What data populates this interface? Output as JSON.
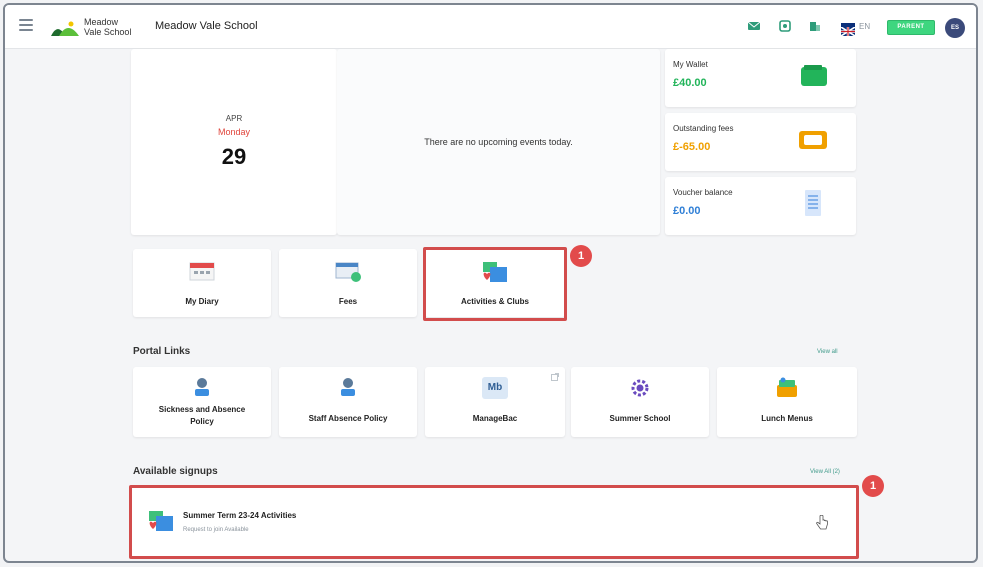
{
  "header": {
    "logo_line1": "Meadow",
    "logo_line2": "Vale School",
    "school_name": "Meadow Vale School",
    "language": "EN",
    "role_badge": "PARENT",
    "avatar_initials": "ES"
  },
  "date_card": {
    "month": "APR",
    "weekday": "Monday",
    "day": "29"
  },
  "events": {
    "empty_message": "There are no upcoming events today."
  },
  "wallet": [
    {
      "label": "My Wallet",
      "value": "£40.00",
      "color": "#22b45a"
    },
    {
      "label": "Outstanding fees",
      "value": "£-65.00",
      "color": "#f0a000"
    },
    {
      "label": "Voucher balance",
      "value": "£0.00",
      "color": "#2f7fd6"
    }
  ],
  "quick_tiles": [
    {
      "label": "My Diary"
    },
    {
      "label": "Fees"
    },
    {
      "label": "Activities & Clubs"
    }
  ],
  "portal_links": {
    "title": "Portal Links",
    "view_all": "View all",
    "items": [
      {
        "label_line1": "Sickness and Absence",
        "label_line2": "Policy"
      },
      {
        "label_line1": "Staff Absence Policy",
        "label_line2": ""
      },
      {
        "label_line1": "ManageBac",
        "label_line2": "",
        "icon_text": "Mb"
      },
      {
        "label_line1": "Summer School",
        "label_line2": ""
      },
      {
        "label_line1": "Lunch Menus",
        "label_line2": ""
      }
    ]
  },
  "signups": {
    "title": "Available signups",
    "view_all": "View All (2)",
    "items": [
      {
        "title": "Summer Term 23-24 Activities",
        "subtitle": "Request to join Available"
      }
    ]
  },
  "annotations": {
    "step_1": "1",
    "step_2": "1"
  },
  "colors": {
    "accent_green": "#3ed67f",
    "highlight_red": "#d24c4c",
    "badge_red": "#e24b4b"
  }
}
